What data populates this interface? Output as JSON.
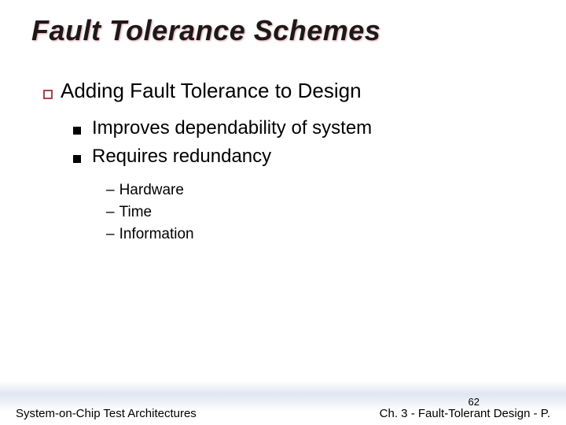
{
  "title": "Fault Tolerance Schemes",
  "level1": {
    "text": "Adding Fault Tolerance to Design"
  },
  "level2": [
    "Improves dependability of system",
    "Requires redundancy"
  ],
  "level3": [
    "Hardware",
    "Time",
    "Information"
  ],
  "footer": {
    "left": "System-on-Chip Test Architectures",
    "right": "Ch. 3 - Fault-Tolerant Design - P.",
    "page": "62"
  }
}
